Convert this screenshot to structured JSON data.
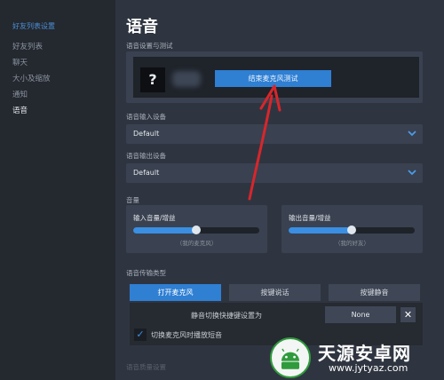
{
  "sidebar": {
    "header": "好友列表设置",
    "items": [
      {
        "label": "好友列表",
        "active": false
      },
      {
        "label": "聊天",
        "active": false
      },
      {
        "label": "大小及缩放",
        "active": false
      },
      {
        "label": "通知",
        "active": false
      },
      {
        "label": "语音",
        "active": true
      }
    ]
  },
  "page": {
    "title": "语音"
  },
  "voice_test": {
    "section_label": "语音设置与测试",
    "avatar_text": "?",
    "end_test_label": "结束麦克风测试"
  },
  "input_device": {
    "label": "语音输入设备",
    "value": "Default"
  },
  "output_device": {
    "label": "语音输出设备",
    "value": "Default"
  },
  "volume": {
    "section_label": "音量",
    "input": {
      "label": "输入音量/增益",
      "caption": "（我的麦克风）",
      "level": 0.5
    },
    "output": {
      "label": "输出音量/增益",
      "caption": "（我的好友）",
      "level": 0.5
    }
  },
  "transmission": {
    "section_label": "语音传输类型",
    "options": [
      {
        "label": "打开麦克风",
        "active": true
      },
      {
        "label": "按键说话",
        "active": false
      },
      {
        "label": "按键静音",
        "active": false
      }
    ],
    "mute_hotkey_label": "静音切换快捷键设置为",
    "hotkey_value": "None",
    "clear_glyph": "✕",
    "play_sound_label": "切换麦克风时播放短音",
    "play_sound_checked": true,
    "check_glyph": "✓"
  },
  "next_section_label": "语音质量设置",
  "colors": {
    "accent": "#2f7fd3",
    "arrow": "#d8262b"
  },
  "watermark": {
    "name": "天源安卓网",
    "url": "www.jytyaz.com"
  }
}
